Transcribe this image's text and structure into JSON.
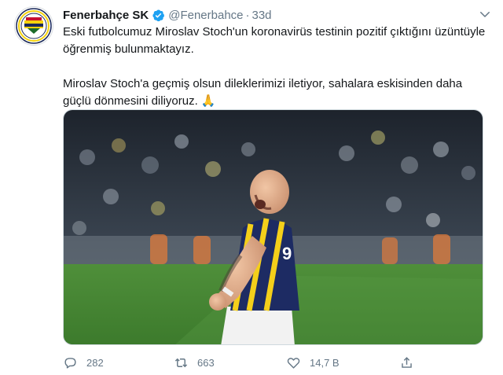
{
  "tweet": {
    "author_name": "Fenerbahçe SK",
    "handle": "@Fenerbahce",
    "separator": "·",
    "time": "33d",
    "paragraphs": [
      "Eski futbolcumuz Miroslav Stoch'un koronavirüs testinin pozitif çıktığını üzüntüyle öğrenmiş bulunmaktayız.",
      "Miroslav Stoch'a geçmiş olsun dileklerimizi iletiyor, sahalara eskisinden daha güçlü dönmesini diliyoruz. 🙏"
    ],
    "replies": "282",
    "retweets": "663",
    "likes": "14,7 B"
  },
  "icons": {
    "verified": "verified-badge-icon",
    "menu": "chevron-down-icon",
    "reply": "reply-icon",
    "retweet": "retweet-icon",
    "like": "heart-icon",
    "share": "share-icon",
    "avatar": "fenerbahce-crest"
  },
  "colors": {
    "verified_blue": "#1da1f2",
    "secondary_text": "#657786",
    "crest_navy": "#1c2a5a",
    "crest_yellow": "#f5d20c"
  }
}
